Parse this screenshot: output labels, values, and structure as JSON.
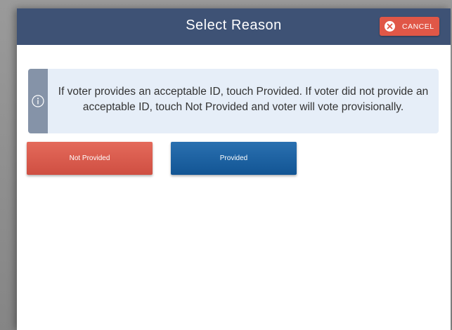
{
  "modal": {
    "title": "Select Reason",
    "cancel_label": "CANCEL",
    "cancel_icon": "close-circle-icon",
    "info_icon": "info-icon",
    "info_text": "If voter provides an acceptable ID, touch Provided. If voter did not provide an acceptable ID, touch Not Provided and voter will vote provisionally."
  },
  "buttons": {
    "not_provided_label": "Not Provided",
    "provided_label": "Provided"
  },
  "colors": {
    "header": "#3e5275",
    "cancel": "#e05747",
    "info_background": "#e6eef8",
    "info_strip": "#8593a8",
    "not_provided": "#d9584a",
    "provided": "#1b62a3"
  }
}
